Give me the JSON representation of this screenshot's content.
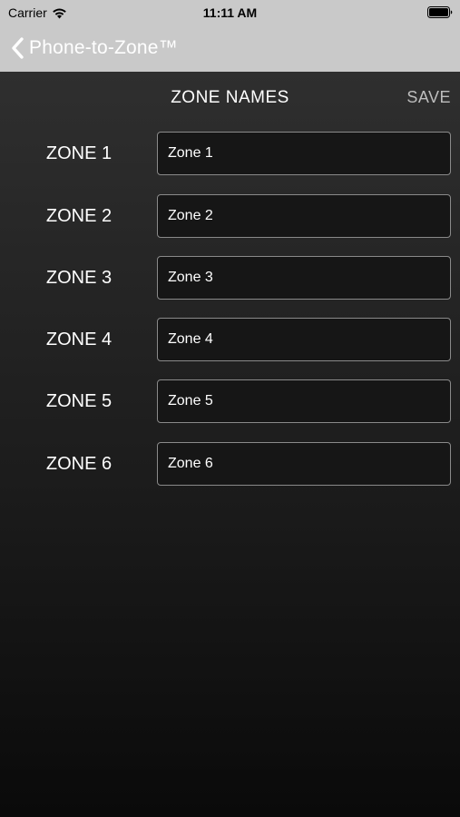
{
  "status_bar": {
    "carrier": "Carrier",
    "time": "11:11 AM",
    "wifi_icon": "wifi-icon",
    "battery_icon": "battery-icon"
  },
  "nav": {
    "back_label": "Phone-to-Zone™",
    "back_icon": "chevron-left-icon"
  },
  "header": {
    "title": "ZONE NAMES",
    "save_label": "SAVE"
  },
  "zones": [
    {
      "label": "ZONE 1",
      "value": "Zone 1"
    },
    {
      "label": "ZONE 2",
      "value": "Zone 2"
    },
    {
      "label": "ZONE 3",
      "value": "Zone 3"
    },
    {
      "label": "ZONE 4",
      "value": "Zone 4"
    },
    {
      "label": "ZONE 5",
      "value": "Zone 5"
    },
    {
      "label": "ZONE 6",
      "value": "Zone 6"
    }
  ],
  "colors": {
    "nav_background": "#c9c9c9",
    "content_top": "#2f2f2f",
    "content_bottom": "#0a0a0a",
    "input_border": "#8a8a8a",
    "save_text": "#bdbdbd"
  }
}
